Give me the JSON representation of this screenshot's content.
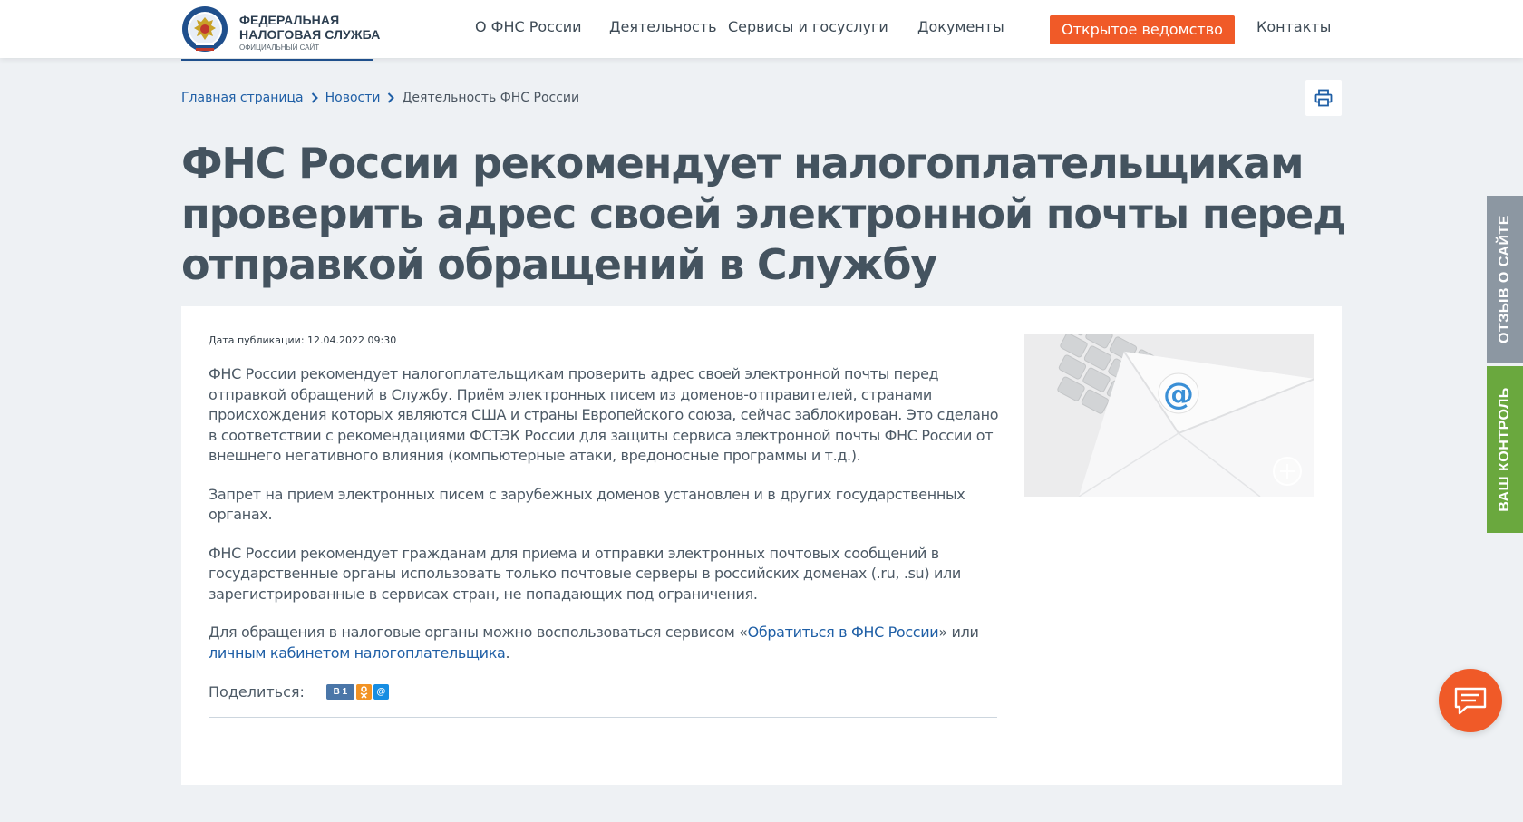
{
  "header": {
    "logo": {
      "line1": "ФЕДЕРАЛЬНАЯ",
      "line2": "НАЛОГОВАЯ СЛУЖБА",
      "subtitle": "ОФИЦИАЛЬНЫЙ САЙТ"
    },
    "nav": [
      {
        "label": "О ФНС России"
      },
      {
        "label": "Деятельность"
      },
      {
        "label": "Сервисы и госуслуги"
      },
      {
        "label": "Документы"
      },
      {
        "label": "Открытое ведомство"
      },
      {
        "label": "Контакты"
      }
    ]
  },
  "breadcrumb": {
    "items": [
      {
        "label": "Главная страница"
      },
      {
        "label": "Новости"
      },
      {
        "label": "Деятельность ФНС России"
      }
    ]
  },
  "print_icon": "printer-icon",
  "title": "ФНС России рекомендует налогоплательщикам проверить адрес своей электронной почты перед отправкой обращений в Службу",
  "article": {
    "pubdate": "Дата публикации: 12.04.2022 09:30",
    "p1": "ФНС России рекомендует налогоплательщикам проверить адрес своей электронной почты перед отправкой обращений в Службу. Приём электронных писем из доменов-отправителей, странами происхождения которых являются США и страны Европейского союза, сейчас заблокирован. Это сделано в соответствии с рекомендациями ФСТЭК России для защиты сервиса электронной почты ФНС России от внешнего негативного влияния (компьютерные атаки, вредоносные программы и т.д.).",
    "p2": "Запрет на прием электронных писем с зарубежных доменов установлен и в других государственных органах.",
    "p3": "ФНС России рекомендует гражданам для приема и отправки электронных почтовых сообщений в государственные органы использовать только почтовые серверы в российских доменах (.ru, .su) или зарегистрированные в сервисах стран, не попадающих под ограничения.",
    "p4_before": "Для обращения в налоговые органы можно воспользоваться сервисом «",
    "p4_link1": "Обратиться в ФНС России",
    "p4_middle": "» или ",
    "p4_link2": "личным кабинетом налогоплательщика",
    "p4_after": "."
  },
  "share": {
    "label": "Поделиться:",
    "vk": "В",
    "vk_count": "1",
    "ok": "ok-icon",
    "mail": "@"
  },
  "side_tabs": {
    "feedback": "ОТЗЫВ О САЙТЕ",
    "control": "ВАШ КОНТРОЛЬ"
  },
  "colors": {
    "accent": "#f05a28",
    "link": "#1f5fa6",
    "feedback_tab": "#8c97a2",
    "control_tab": "#6aa83e"
  }
}
